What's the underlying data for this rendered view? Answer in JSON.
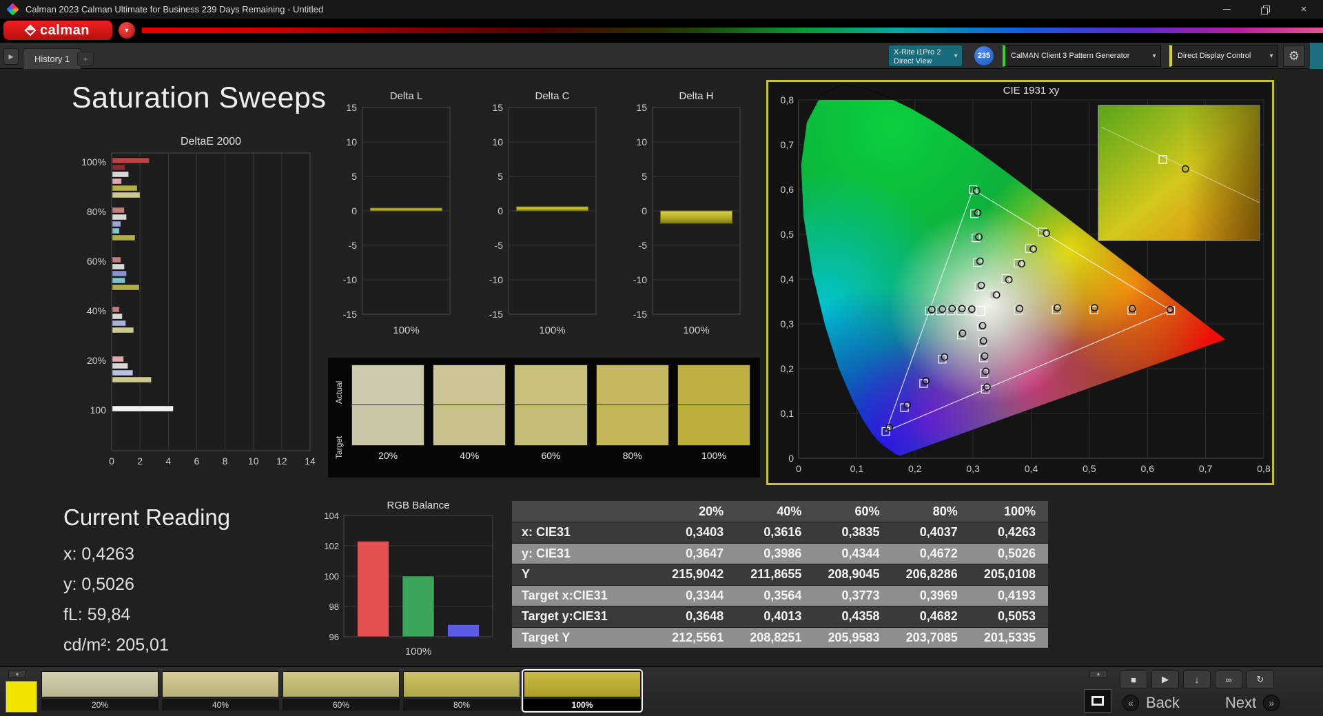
{
  "window": {
    "title": "Calman 2023 Calman Ultimate for Business 239 Days Remaining  - Untitled",
    "close_glyph": "×"
  },
  "brand": {
    "name": "calman"
  },
  "tabbar": {
    "tab": "History 1",
    "add_glyph": "+",
    "arrow_glyph": "▶"
  },
  "toolbar": {
    "meter_line1": "X-Rite i1Pro 2",
    "meter_line2": "Direct View",
    "meter_badge": "235",
    "pattern_generator": "CalMAN Client 3 Pattern Generator",
    "display_control": "Direct Display Control",
    "gear_glyph": "⚙",
    "caret_glyph": "▼"
  },
  "page": {
    "title": "Saturation Sweeps"
  },
  "current_reading": {
    "title": "Current Reading",
    "lines": [
      "x: 0,4263",
      "y: 0,5026",
      "fL: 59,84",
      "cd/m²: 205,01"
    ]
  },
  "swatch_panel": {
    "row_labels": [
      "Actual",
      "Target"
    ],
    "levels": [
      "20%",
      "40%",
      "60%",
      "80%",
      "100%"
    ],
    "actual_colors": [
      "#cdc9ac",
      "#cbc595",
      "#c8c07b",
      "#c4b960",
      "#bfb13f"
    ],
    "target_colors": [
      "#cac6a5",
      "#c8c28e",
      "#c5bd74",
      "#c1b65a",
      "#bcae3a"
    ]
  },
  "chart_data": {
    "delta_e": {
      "type": "bar",
      "orientation": "horizontal",
      "title": "DeltaE 2000",
      "xlim": [
        0,
        14
      ],
      "xticks": [
        0,
        2,
        4,
        6,
        8,
        10,
        12,
        14
      ],
      "groups": [
        {
          "label": "100%",
          "bars": [
            {
              "color": "#b94343",
              "value": 2.6
            },
            {
              "color": "#8a2f2f",
              "value": 0.9
            },
            {
              "color": "#d9d9d9",
              "value": 1.15
            },
            {
              "color": "#e3a6ad",
              "value": 0.65
            },
            {
              "color": "#b4ae4a",
              "value": 1.75
            },
            {
              "color": "#cdc98f",
              "value": 1.95
            }
          ]
        },
        {
          "label": "80%",
          "bars": [
            {
              "color": "#c27d7d",
              "value": 0.85
            },
            {
              "color": "#d9d9d9",
              "value": 1.0
            },
            {
              "color": "#9aa3d6",
              "value": 0.6
            },
            {
              "color": "#7fc4cc",
              "value": 0.5
            },
            {
              "color": "#b4ae4a",
              "value": 1.6
            }
          ]
        },
        {
          "label": "60%",
          "bars": [
            {
              "color": "#c27d7d",
              "value": 0.6
            },
            {
              "color": "#d9d9d9",
              "value": 0.85
            },
            {
              "color": "#8a93cf",
              "value": 1.0
            },
            {
              "color": "#7fc4cc",
              "value": 0.9
            },
            {
              "color": "#b4ae4a",
              "value": 1.9
            }
          ]
        },
        {
          "label": "40%",
          "bars": [
            {
              "color": "#c27d7d",
              "value": 0.5
            },
            {
              "color": "#d9d9d9",
              "value": 0.7
            },
            {
              "color": "#a8b0dd",
              "value": 0.95
            },
            {
              "color": "#cdc98f",
              "value": 1.5
            }
          ]
        },
        {
          "label": "20%",
          "bars": [
            {
              "color": "#e3a6ad",
              "value": 0.8
            },
            {
              "color": "#d9d9d9",
              "value": 1.1
            },
            {
              "color": "#b9bfe8",
              "value": 1.45
            },
            {
              "color": "#cdc98f",
              "value": 2.75
            }
          ]
        },
        {
          "label": "100",
          "bars": [
            {
              "color": "#f2f2f2",
              "value": 4.3
            }
          ]
        }
      ]
    },
    "delta_l": {
      "type": "bar",
      "title": "Delta L",
      "ylim": [
        -15,
        15
      ],
      "yticks": [
        15,
        10,
        5,
        0,
        -5,
        -10,
        -15
      ],
      "category": "100%",
      "value": 0.4
    },
    "delta_c": {
      "type": "bar",
      "title": "Delta C",
      "ylim": [
        -15,
        15
      ],
      "yticks": [
        15,
        10,
        5,
        0,
        -5,
        -10,
        -15
      ],
      "category": "100%",
      "value": 0.6
    },
    "delta_h": {
      "type": "bar",
      "title": "Delta H",
      "ylim": [
        -15,
        15
      ],
      "yticks": [
        15,
        10,
        5,
        0,
        -5,
        -10,
        -15
      ],
      "category": "100%",
      "value": -1.8
    },
    "rgb_balance": {
      "type": "bar",
      "title": "RGB Balance",
      "ylim": [
        96,
        104
      ],
      "yticks": [
        104,
        102,
        100,
        98,
        96
      ],
      "category": "100%",
      "series": [
        {
          "name": "Red",
          "value": 102.3,
          "color": "#e35050"
        },
        {
          "name": "Green",
          "value": 100.0,
          "color": "#3da45c"
        },
        {
          "name": "Blue",
          "value": 96.8,
          "color": "#5b5be6"
        }
      ]
    },
    "cie": {
      "type": "scatter",
      "title": "CIE 1931 xy",
      "xlim": [
        0,
        0.8
      ],
      "ylim": [
        0,
        0.8
      ],
      "xticks": [
        "0",
        "0,1",
        "0,2",
        "0,3",
        "0,4",
        "0,5",
        "0,6",
        "0,7",
        "0,8"
      ],
      "yticks": [
        "0",
        "0,1",
        "0,2",
        "0,3",
        "0,4",
        "0,5",
        "0,6",
        "0,7",
        "0,8"
      ],
      "gamut_triangle": [
        [
          0.64,
          0.33
        ],
        [
          0.3,
          0.6
        ],
        [
          0.15,
          0.06
        ]
      ],
      "white_point": [
        0.3127,
        0.329
      ],
      "target_points": [
        [
          0.296,
          0.329
        ],
        [
          0.279,
          0.329
        ],
        [
          0.262,
          0.329
        ],
        [
          0.244,
          0.329
        ],
        [
          0.225,
          0.329
        ],
        [
          0.378,
          0.33
        ],
        [
          0.443,
          0.331
        ],
        [
          0.508,
          0.331
        ],
        [
          0.573,
          0.33
        ],
        [
          0.64,
          0.33
        ],
        [
          0.31,
          0.383
        ],
        [
          0.3075,
          0.437
        ],
        [
          0.305,
          0.492
        ],
        [
          0.3025,
          0.546
        ],
        [
          0.3,
          0.6
        ],
        [
          0.3344,
          0.3648
        ],
        [
          0.3564,
          0.4013
        ],
        [
          0.3773,
          0.4358
        ],
        [
          0.3969,
          0.4682
        ],
        [
          0.4193,
          0.5053
        ],
        [
          0.28,
          0.275
        ],
        [
          0.247,
          0.221
        ],
        [
          0.215,
          0.167
        ],
        [
          0.182,
          0.113
        ],
        [
          0.15,
          0.06
        ],
        [
          0.3145,
          0.294
        ],
        [
          0.316,
          0.259
        ],
        [
          0.3175,
          0.224
        ],
        [
          0.319,
          0.189
        ],
        [
          0.321,
          0.154
        ]
      ],
      "measured_points": [
        [
          0.298,
          0.333
        ],
        [
          0.281,
          0.334
        ],
        [
          0.264,
          0.334
        ],
        [
          0.247,
          0.333
        ],
        [
          0.229,
          0.332
        ],
        [
          0.38,
          0.334
        ],
        [
          0.445,
          0.336
        ],
        [
          0.509,
          0.336
        ],
        [
          0.574,
          0.334
        ],
        [
          0.639,
          0.332
        ],
        [
          0.314,
          0.386
        ],
        [
          0.312,
          0.44
        ],
        [
          0.31,
          0.494
        ],
        [
          0.308,
          0.548
        ],
        [
          0.306,
          0.597
        ],
        [
          0.3403,
          0.3647
        ],
        [
          0.3616,
          0.3986
        ],
        [
          0.3835,
          0.4344
        ],
        [
          0.4037,
          0.4672
        ],
        [
          0.4263,
          0.5026
        ],
        [
          0.282,
          0.279
        ],
        [
          0.251,
          0.226
        ],
        [
          0.219,
          0.173
        ],
        [
          0.187,
          0.119
        ],
        [
          0.156,
          0.069
        ],
        [
          0.3165,
          0.296
        ],
        [
          0.318,
          0.262
        ],
        [
          0.32,
          0.228
        ],
        [
          0.322,
          0.194
        ],
        [
          0.324,
          0.159
        ]
      ]
    },
    "results_table": {
      "type": "table",
      "columns": [
        "20%",
        "40%",
        "60%",
        "80%",
        "100%"
      ],
      "rows": [
        {
          "label": "x: CIE31",
          "values": [
            "0,3403",
            "0,3616",
            "0,3835",
            "0,4037",
            "0,4263"
          ]
        },
        {
          "label": "y: CIE31",
          "values": [
            "0,3647",
            "0,3986",
            "0,4344",
            "0,4672",
            "0,5026"
          ]
        },
        {
          "label": "Y",
          "values": [
            "215,9042",
            "211,8655",
            "208,9045",
            "206,8286",
            "205,0108"
          ]
        },
        {
          "label": "Target x:CIE31",
          "values": [
            "0,3344",
            "0,3564",
            "0,3773",
            "0,3969",
            "0,4193"
          ]
        },
        {
          "label": "Target y:CIE31",
          "values": [
            "0,3648",
            "0,4013",
            "0,4358",
            "0,4682",
            "0,5053"
          ]
        },
        {
          "label": "Target Y",
          "values": [
            "212,5561",
            "208,8251",
            "205,9583",
            "203,7085",
            "201,5335"
          ]
        }
      ]
    }
  },
  "bottom_bar": {
    "up_glyph": "▲",
    "current_patch_color": "#f2e600",
    "swatches": [
      {
        "label": "20%",
        "color": "#ccc8a6"
      },
      {
        "label": "40%",
        "color": "#cac590"
      },
      {
        "label": "60%",
        "color": "#c7c078"
      },
      {
        "label": "80%",
        "color": "#c3ba5e"
      },
      {
        "label": "100%",
        "color": "#beb23b",
        "active": true
      }
    ],
    "transport": [
      {
        "name": "stop",
        "glyph": "■"
      },
      {
        "name": "play",
        "glyph": "▶"
      },
      {
        "name": "save",
        "glyph": "↓"
      },
      {
        "name": "loop",
        "glyph": "∞"
      },
      {
        "name": "refresh",
        "glyph": "↻"
      }
    ],
    "back_label": "Back",
    "next_label": "Next",
    "back_glyph": "«",
    "next_glyph": "»"
  }
}
